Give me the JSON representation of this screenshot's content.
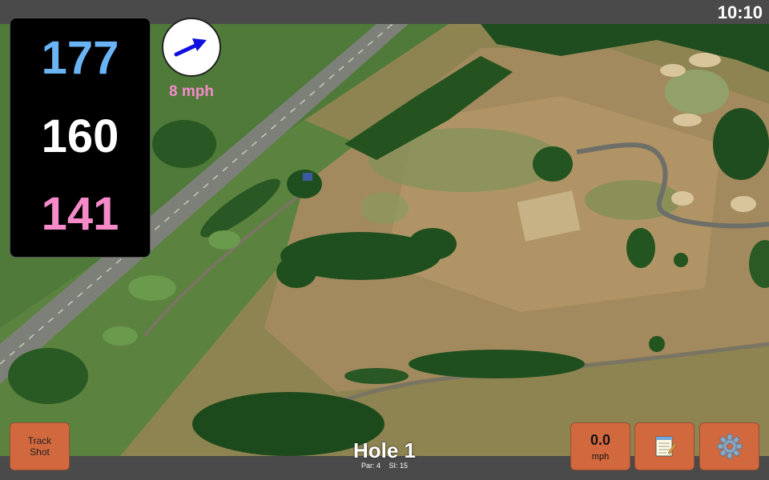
{
  "status_bar": {
    "time": "10:10"
  },
  "yardage": {
    "back": "177",
    "middle": "160",
    "front": "141",
    "colors": {
      "back": "#6ab4f5",
      "middle": "#ffffff",
      "front": "#f58ac8"
    }
  },
  "wind": {
    "speed": "8 mph",
    "arrow_icon": "wind-arrow-icon",
    "arrow_color": "#1010e0",
    "text_color": "#f58ac8"
  },
  "buttons": {
    "track_shot": "Track\nShot",
    "speed_value": "0.0",
    "speed_unit": "mph",
    "notes_icon": "notepad-icon",
    "settings_icon": "gear-icon",
    "button_color": "#d2693e"
  },
  "hole": {
    "title": "Hole 1",
    "par": "Par: 4",
    "si": "SI: 15"
  }
}
